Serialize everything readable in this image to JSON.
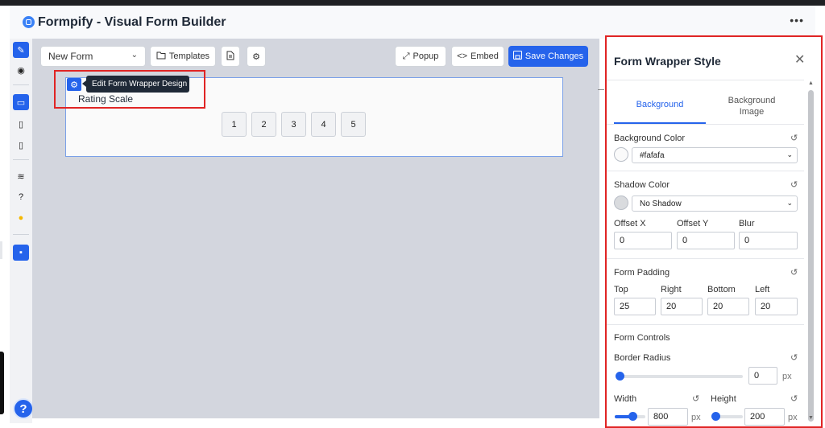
{
  "app": {
    "title": "Formpify - Visual Form Builder",
    "more_icon": "more-horizontal-icon"
  },
  "toolbar": {
    "form_select": "New Form",
    "templates_label": "Templates",
    "popup_label": "Popup",
    "embed_label": "Embed",
    "save_label": "Save Changes"
  },
  "sidebar": {
    "items": [
      {
        "icon": "edit-icon",
        "glyph": "✎"
      },
      {
        "icon": "preview-eye-icon",
        "glyph": "◉"
      },
      {
        "icon": "desktop-icon",
        "glyph": "▭"
      },
      {
        "icon": "tablet-icon",
        "glyph": "▯"
      },
      {
        "icon": "mobile-icon",
        "glyph": "▯"
      },
      {
        "icon": "layers-icon",
        "glyph": "≋"
      },
      {
        "icon": "help-circle-icon",
        "glyph": "?"
      },
      {
        "icon": "lightbulb-icon",
        "glyph": "●"
      },
      {
        "icon": "save-icon",
        "glyph": "▪"
      }
    ],
    "help": "?"
  },
  "canvas": {
    "tooltip": "Edit Form Wrapper Design",
    "field_label": "Rating Scale",
    "rating_options": [
      "1",
      "2",
      "3",
      "4",
      "5"
    ]
  },
  "panel": {
    "title": "Form Wrapper Style",
    "tabs": [
      {
        "label": "Background",
        "active": true
      },
      {
        "label": "Background Image",
        "active": false
      }
    ],
    "background_color": {
      "label": "Background Color",
      "value": "#fafafa"
    },
    "shadow": {
      "label": "Shadow Color",
      "value": "No Shadow",
      "offset_x_label": "Offset X",
      "offset_y_label": "Offset Y",
      "blur_label": "Blur",
      "offset_x": "0",
      "offset_y": "0",
      "blur": "0"
    },
    "padding": {
      "label": "Form Padding",
      "top_label": "Top",
      "right_label": "Right",
      "bottom_label": "Bottom",
      "left_label": "Left",
      "top": "25",
      "right": "20",
      "bottom": "20",
      "left": "20"
    },
    "controls": {
      "label": "Form Controls",
      "border_radius_label": "Border Radius",
      "border_radius": "0",
      "border_radius_unit": "px",
      "width_label": "Width",
      "width": "800",
      "width_unit": "px",
      "height_label": "Height",
      "height": "200",
      "height_unit": "px"
    }
  },
  "colors": {
    "accent": "#2563eb",
    "highlight": "#e02424",
    "canvas": "#d3d6de",
    "form_bg": "#fafafa"
  }
}
